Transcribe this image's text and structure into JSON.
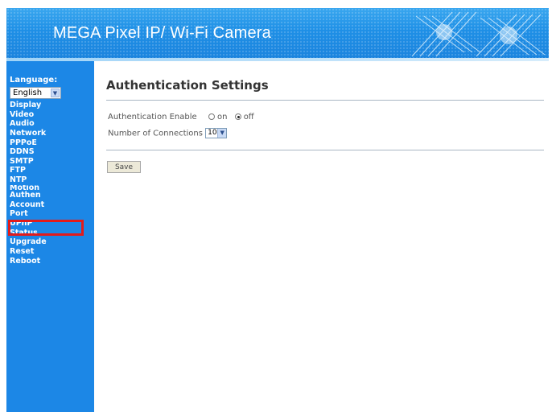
{
  "header": {
    "title": "MEGA Pixel IP/ Wi-Fi Camera"
  },
  "sidebar": {
    "language_label": "Language:",
    "language_value": "English",
    "items": [
      {
        "label": "Display"
      },
      {
        "label": "Video"
      },
      {
        "label": "Audio"
      },
      {
        "label": "Network"
      },
      {
        "label": "PPPoE"
      },
      {
        "label": "DDNS"
      },
      {
        "label": "SMTP"
      },
      {
        "label": "FTP"
      },
      {
        "label": "NTP"
      },
      {
        "label": "Motion"
      },
      {
        "label": "Authen"
      },
      {
        "label": "Account"
      },
      {
        "label": "Port"
      },
      {
        "label": "UPnP"
      },
      {
        "label": "Status"
      },
      {
        "label": "Upgrade"
      },
      {
        "label": "Reset"
      },
      {
        "label": "Reboot"
      }
    ],
    "highlight_color": "#e21b1b",
    "background_color": "#1c87e6"
  },
  "main": {
    "title": "Authentication Settings",
    "auth_enable_label": "Authentication Enable",
    "option_on": "on",
    "option_off": "off",
    "auth_enable_selected": "off",
    "connections_label": "Number of Connections",
    "connections_value": "10",
    "save_label": "Save"
  }
}
